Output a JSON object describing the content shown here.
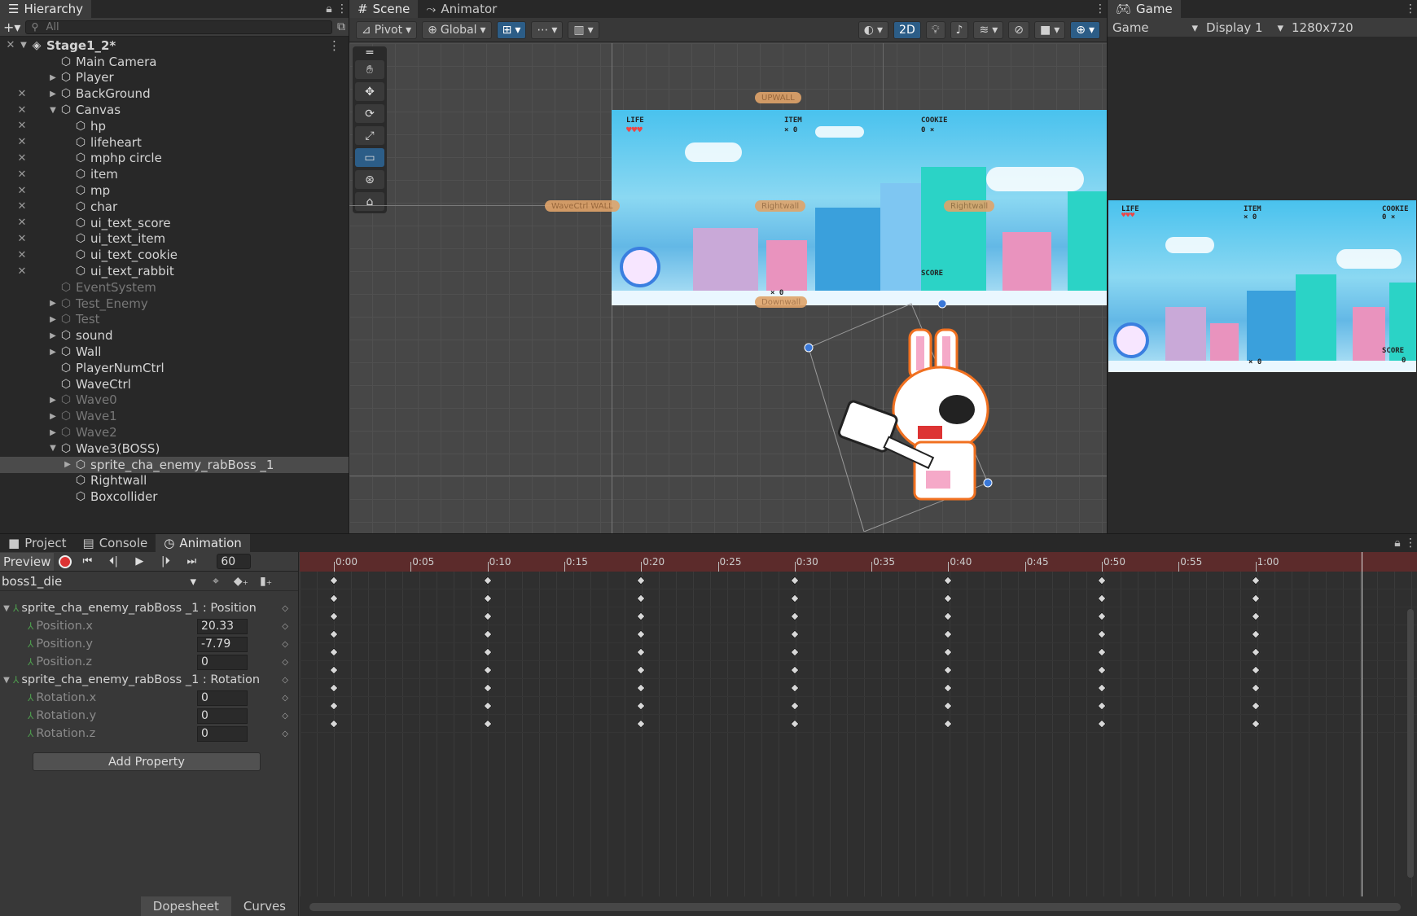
{
  "hierarchy": {
    "tab_label": "Hierarchy",
    "search_placeholder": "All",
    "scene_name": "Stage1_2*",
    "items": [
      {
        "label": "Main Camera",
        "depth": 1,
        "arrow": "",
        "dim": false,
        "vis": false
      },
      {
        "label": "Player",
        "depth": 1,
        "arrow": "▶",
        "dim": false,
        "vis": false
      },
      {
        "label": "BackGround",
        "depth": 1,
        "arrow": "▶",
        "dim": false,
        "vis": true
      },
      {
        "label": "Canvas",
        "depth": 1,
        "arrow": "▼",
        "dim": false,
        "vis": true
      },
      {
        "label": "hp",
        "depth": 2,
        "arrow": "",
        "dim": false,
        "vis": true
      },
      {
        "label": "lifeheart",
        "depth": 2,
        "arrow": "",
        "dim": false,
        "vis": true
      },
      {
        "label": "mphp circle",
        "depth": 2,
        "arrow": "",
        "dim": false,
        "vis": true
      },
      {
        "label": "item",
        "depth": 2,
        "arrow": "",
        "dim": false,
        "vis": true
      },
      {
        "label": "mp",
        "depth": 2,
        "arrow": "",
        "dim": false,
        "vis": true
      },
      {
        "label": "char",
        "depth": 2,
        "arrow": "",
        "dim": false,
        "vis": true
      },
      {
        "label": "ui_text_score",
        "depth": 2,
        "arrow": "",
        "dim": false,
        "vis": true
      },
      {
        "label": "ui_text_item",
        "depth": 2,
        "arrow": "",
        "dim": false,
        "vis": true
      },
      {
        "label": "ui_text_cookie",
        "depth": 2,
        "arrow": "",
        "dim": false,
        "vis": true
      },
      {
        "label": "ui_text_rabbit",
        "depth": 2,
        "arrow": "",
        "dim": false,
        "vis": true
      },
      {
        "label": "EventSystem",
        "depth": 1,
        "arrow": "",
        "dim": true,
        "vis": false
      },
      {
        "label": "Test_Enemy",
        "depth": 1,
        "arrow": "▶",
        "dim": true,
        "vis": false
      },
      {
        "label": "Test",
        "depth": 1,
        "arrow": "▶",
        "dim": true,
        "vis": false
      },
      {
        "label": "sound",
        "depth": 1,
        "arrow": "▶",
        "dim": false,
        "vis": false
      },
      {
        "label": "Wall",
        "depth": 1,
        "arrow": "▶",
        "dim": false,
        "vis": false
      },
      {
        "label": "PlayerNumCtrl",
        "depth": 1,
        "arrow": "",
        "dim": false,
        "vis": false
      },
      {
        "label": "WaveCtrl",
        "depth": 1,
        "arrow": "",
        "dim": false,
        "vis": false
      },
      {
        "label": "Wave0",
        "depth": 1,
        "arrow": "▶",
        "dim": true,
        "vis": false
      },
      {
        "label": "Wave1",
        "depth": 1,
        "arrow": "▶",
        "dim": true,
        "vis": false
      },
      {
        "label": "Wave2",
        "depth": 1,
        "arrow": "▶",
        "dim": true,
        "vis": false
      },
      {
        "label": "Wave3(BOSS)",
        "depth": 1,
        "arrow": "▼",
        "dim": false,
        "vis": false
      },
      {
        "label": "sprite_cha_enemy_rabBoss _1",
        "depth": 2,
        "arrow": "▶",
        "dim": false,
        "vis": false,
        "selected": true
      },
      {
        "label": "Rightwall",
        "depth": 2,
        "arrow": "",
        "dim": false,
        "vis": false
      },
      {
        "label": "Boxcollider",
        "depth": 2,
        "arrow": "",
        "dim": false,
        "vis": false
      }
    ]
  },
  "scene": {
    "tab_scene": "Scene",
    "tab_animator": "Animator",
    "pivot": "Pivot",
    "global": "Global",
    "mode_2d": "2D",
    "labels": {
      "upwall": "UPWALL",
      "wavectrl": "WaveCtrl WALL",
      "rightwall1": "Rightwall",
      "rightwall2": "Rightwall",
      "downwall": "Downwall",
      "life": "LIFE",
      "item": "ITEM",
      "item_count": "× 0",
      "cookie": "COOKIE",
      "cookie_count": "0 ×",
      "score": "SCORE",
      "bottom_count": "× 0"
    }
  },
  "game": {
    "tab_label": "Game",
    "view": "Game",
    "display": "Display 1",
    "resolution": "1280x720",
    "labels": {
      "life": "LIFE",
      "item": "ITEM",
      "item_count": "× 0",
      "cookie": "COOKIE",
      "cookie_count": "0 ×",
      "score": "SCORE",
      "score_value": "0",
      "bottom_count": "× 0"
    }
  },
  "animation": {
    "tabs": {
      "project": "Project",
      "console": "Console",
      "animation": "Animation"
    },
    "preview": "Preview",
    "frame": "60",
    "clip": "boss1_die",
    "groups": [
      {
        "label": "sprite_cha_enemy_rabBoss _1 : Position",
        "children": [
          {
            "label": "Position.x",
            "value": "20.33"
          },
          {
            "label": "Position.y",
            "value": "-7.79"
          },
          {
            "label": "Position.z",
            "value": "0"
          }
        ]
      },
      {
        "label": "sprite_cha_enemy_rabBoss _1 : Rotation",
        "children": [
          {
            "label": "Rotation.x",
            "value": "0"
          },
          {
            "label": "Rotation.y",
            "value": "0"
          },
          {
            "label": "Rotation.z",
            "value": "0"
          }
        ]
      }
    ],
    "add_property": "Add Property",
    "dopesheet": "Dopesheet",
    "curves": "Curves",
    "ruler": [
      "0:00",
      "0:05",
      "0:10",
      "0:15",
      "0:20",
      "0:25",
      "0:30",
      "0:35",
      "0:40",
      "0:45",
      "0:50",
      "0:55",
      "1:00"
    ],
    "keyframe_times": [
      "0:00",
      "0:10",
      "0:20",
      "0:30",
      "0:40",
      "0:50",
      "1:00"
    ]
  }
}
